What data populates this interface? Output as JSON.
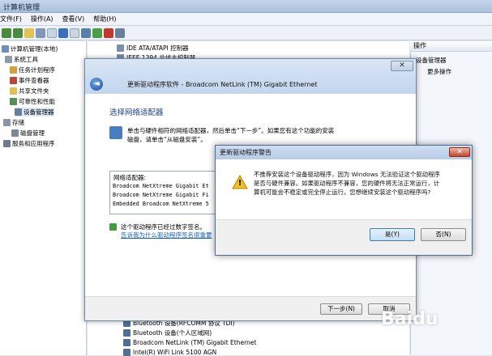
{
  "window": {
    "title": "计算机管理"
  },
  "menu": [
    "文件(F)",
    "操作(A)",
    "查看(V)",
    "帮助(H)"
  ],
  "tree": {
    "root": "计算机管理(本地)",
    "system_tools": "系统工具",
    "task_scheduler": "任务计划程序",
    "event_viewer": "事件查看器",
    "shared_folders": "共享文件夹",
    "performance": "可靠性和性能",
    "device_manager": "设备管理器",
    "storage": "存储",
    "disk_mgmt": "磁盘管理",
    "services": "服务和应用程序"
  },
  "device_list": {
    "top_items": [
      "IDE ATA/ATAPI 控制器",
      "IEEE 1394 总线主控制器"
    ],
    "bottom_items": [
      "Bluetooth 设备(RFCOMM 协议 TDI)",
      "Bluetooth 设备(个人区域网)",
      "Broadcom NetLink (TM) Gigabit Ethernet",
      "Intel(R) WiFi Link 5100 AGN"
    ]
  },
  "actions": {
    "header": "操作",
    "section": "设备管理器",
    "more": "更多操作"
  },
  "wizard": {
    "close_symbol": "✕",
    "back_symbol": "◄",
    "title": "更新驱动程序软件 - Broadcom NetLink (TM) Gigabit Ethernet",
    "heading": "选择网络适配器",
    "instruction_line1": "单击与硬件相符的网络适配器，然后单击“下一步”。如果您有这个功能的安装",
    "instruction_line2": "磁盘，请单击“从磁盘安装”。",
    "list_label": "网络适配器:",
    "adapters": [
      "Broadcom NetXtreme Gigabit Et",
      "Broadcom NetXtreme Gigabit Fi",
      "Embedded Broadcom NetXtreme 5"
    ],
    "signed_text": "这个驱动程序已经过数字签名。",
    "signed_link": "告诉我为什么驱动程序签名很重要",
    "next_button": "下一步(N)",
    "cancel_button": "取消"
  },
  "alert": {
    "title": "更新驱动程序警告",
    "close_symbol": "✕",
    "message_lines": [
      "不推荐安装这个设备驱动程序，因为 Windows 无法验证这个驱动程序",
      "是否与硬件兼容。如果驱动程序不兼容，您的硬件将无法正常运行，计",
      "算机可能会不稳定或完全停止运行。您想继续安装这个驱动程序吗?"
    ],
    "yes_button": "是(Y)",
    "no_button": "否(N)",
    "warning_glyph": "!"
  },
  "watermark": "Baidu"
}
